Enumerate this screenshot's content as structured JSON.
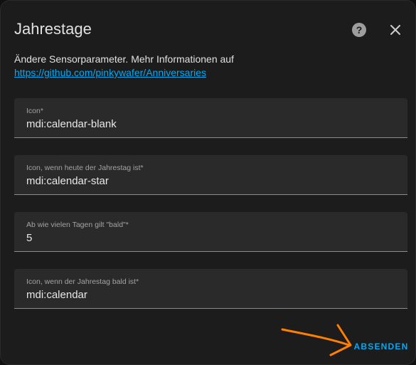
{
  "dialog": {
    "title": "Jahrestage",
    "description": "Ändere Sensorparameter. Mehr Informationen auf",
    "link_text": "https://github.com/pinkywafer/Anniversaries",
    "help_icon": "help-circle-icon",
    "close_icon": "close-icon"
  },
  "fields": [
    {
      "label": "Icon*",
      "value": "mdi:calendar-blank"
    },
    {
      "label": "Icon, wenn heute der Jahrestag ist*",
      "value": "mdi:calendar-star"
    },
    {
      "label": "Ab wie vielen Tagen gilt \"bald\"*",
      "value": "5"
    },
    {
      "label": "Icon, wenn der Jahrestag bald ist*",
      "value": "mdi:calendar"
    }
  ],
  "actions": {
    "submit_label": "ABSENDEN"
  },
  "annotation": {
    "arrow_color": "#ff7f00"
  },
  "colors": {
    "accent": "#03a9f4",
    "background": "#1c1c1c",
    "field_background": "#2a2a2a"
  }
}
